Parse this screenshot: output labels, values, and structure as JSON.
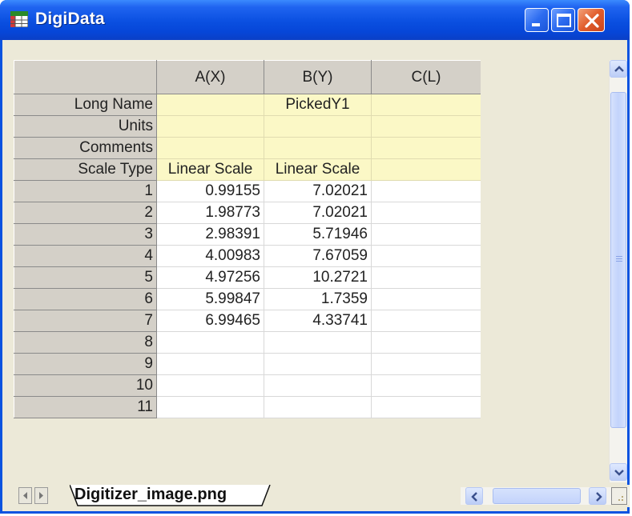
{
  "window": {
    "title": "DigiData"
  },
  "columns": [
    "A(X)",
    "B(Y)",
    "C(L)"
  ],
  "meta_rows": [
    {
      "label": "Long Name",
      "values": [
        "",
        "PickedY1",
        ""
      ]
    },
    {
      "label": "Units",
      "values": [
        "",
        "",
        ""
      ]
    },
    {
      "label": "Comments",
      "values": [
        "",
        "",
        ""
      ]
    },
    {
      "label": "Scale Type",
      "values": [
        "Linear Scale",
        "Linear Scale",
        ""
      ]
    }
  ],
  "rows": [
    {
      "index": "1",
      "values": [
        "0.99155",
        "7.02021",
        ""
      ]
    },
    {
      "index": "2",
      "values": [
        "1.98773",
        "7.02021",
        ""
      ]
    },
    {
      "index": "3",
      "values": [
        "2.98391",
        "5.71946",
        ""
      ]
    },
    {
      "index": "4",
      "values": [
        "4.00983",
        "7.67059",
        ""
      ]
    },
    {
      "index": "5",
      "values": [
        "4.97256",
        "10.2721",
        ""
      ]
    },
    {
      "index": "6",
      "values": [
        "5.99847",
        "1.7359",
        ""
      ]
    },
    {
      "index": "7",
      "values": [
        "6.99465",
        "4.33741",
        ""
      ]
    },
    {
      "index": "8",
      "values": [
        "",
        "",
        ""
      ]
    },
    {
      "index": "9",
      "values": [
        "",
        "",
        ""
      ]
    },
    {
      "index": "10",
      "values": [
        "",
        "",
        ""
      ]
    },
    {
      "index": "11",
      "values": [
        "",
        "",
        ""
      ]
    }
  ],
  "sheet_tab": {
    "label": "Digitizer_image.png"
  },
  "icons": {
    "app": "worksheet-icon",
    "minimize": "minimize-icon",
    "maximize": "maximize-icon",
    "close": "close-icon"
  },
  "colors": {
    "titlebar": "#0a4fe0",
    "header_bg": "#d4d0c8",
    "meta_bg": "#fbf8c6",
    "close_button": "#e15d2c"
  }
}
